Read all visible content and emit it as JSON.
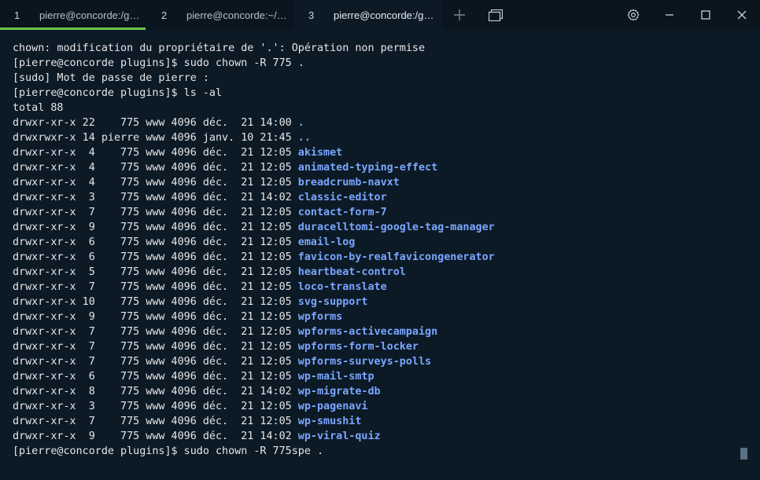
{
  "tabs": [
    {
      "num": "1",
      "label": "pierre@concorde:/g…",
      "active": false
    },
    {
      "num": "2",
      "label": "pierre@concorde:~/…",
      "active": false
    },
    {
      "num": "3",
      "label": "pierre@concorde:/g…",
      "active": true
    }
  ],
  "terminal": {
    "lines": [
      {
        "text": "chown: modification du propriétaire de '.': Opération non permise"
      },
      {
        "text": "[pierre@concorde plugins]$ sudo chown -R 775 ."
      },
      {
        "text": "[sudo] Mot de passe de pierre :"
      },
      {
        "text": "[pierre@concorde plugins]$ ls -al"
      },
      {
        "text": "total 88"
      },
      {
        "text": "drwxr-xr-x 22    775 www 4096 déc.  21 14:00 ",
        "dir": "."
      },
      {
        "text": "drwxrwxr-x 14 pierre www 4096 janv. 10 21:45 ",
        "dir": ".."
      },
      {
        "text": "drwxr-xr-x  4    775 www 4096 déc.  21 12:05 ",
        "dir": "akismet"
      },
      {
        "text": "drwxr-xr-x  4    775 www 4096 déc.  21 12:05 ",
        "dir": "animated-typing-effect"
      },
      {
        "text": "drwxr-xr-x  4    775 www 4096 déc.  21 12:05 ",
        "dir": "breadcrumb-navxt"
      },
      {
        "text": "drwxr-xr-x  3    775 www 4096 déc.  21 14:02 ",
        "dir": "classic-editor"
      },
      {
        "text": "drwxr-xr-x  7    775 www 4096 déc.  21 12:05 ",
        "dir": "contact-form-7"
      },
      {
        "text": "drwxr-xr-x  9    775 www 4096 déc.  21 12:05 ",
        "dir": "duracelltomi-google-tag-manager"
      },
      {
        "text": "drwxr-xr-x  6    775 www 4096 déc.  21 12:05 ",
        "dir": "email-log"
      },
      {
        "text": "drwxr-xr-x  6    775 www 4096 déc.  21 12:05 ",
        "dir": "favicon-by-realfavicongenerator"
      },
      {
        "text": "drwxr-xr-x  5    775 www 4096 déc.  21 12:05 ",
        "dir": "heartbeat-control"
      },
      {
        "text": "drwxr-xr-x  7    775 www 4096 déc.  21 12:05 ",
        "dir": "loco-translate"
      },
      {
        "text": "drwxr-xr-x 10    775 www 4096 déc.  21 12:05 ",
        "dir": "svg-support"
      },
      {
        "text": "drwxr-xr-x  9    775 www 4096 déc.  21 12:05 ",
        "dir": "wpforms"
      },
      {
        "text": "drwxr-xr-x  7    775 www 4096 déc.  21 12:05 ",
        "dir": "wpforms-activecampaign"
      },
      {
        "text": "drwxr-xr-x  7    775 www 4096 déc.  21 12:05 ",
        "dir": "wpforms-form-locker"
      },
      {
        "text": "drwxr-xr-x  7    775 www 4096 déc.  21 12:05 ",
        "dir": "wpforms-surveys-polls"
      },
      {
        "text": "drwxr-xr-x  6    775 www 4096 déc.  21 12:05 ",
        "dir": "wp-mail-smtp"
      },
      {
        "text": "drwxr-xr-x  8    775 www 4096 déc.  21 14:02 ",
        "dir": "wp-migrate-db"
      },
      {
        "text": "drwxr-xr-x  3    775 www 4096 déc.  21 12:05 ",
        "dir": "wp-pagenavi"
      },
      {
        "text": "drwxr-xr-x  7    775 www 4096 déc.  21 12:05 ",
        "dir": "wp-smushit"
      },
      {
        "text": "drwxr-xr-x  9    775 www 4096 déc.  21 14:02 ",
        "dir": "wp-viral-quiz"
      },
      {
        "text": "[pierre@concorde plugins]$ sudo chown -R 775spe ."
      }
    ]
  },
  "icons": {
    "new_tab": "plus-icon",
    "tab_overview": "tab-overview-icon",
    "settings": "gear-icon",
    "minimize": "minimize-icon",
    "maximize": "maximize-icon",
    "close": "close-icon"
  },
  "colors": {
    "background": "#0c1a26",
    "tabbar": "#0a1520",
    "active_tab_indicator": "#6cc24a",
    "directory": "#7aa6ff"
  }
}
